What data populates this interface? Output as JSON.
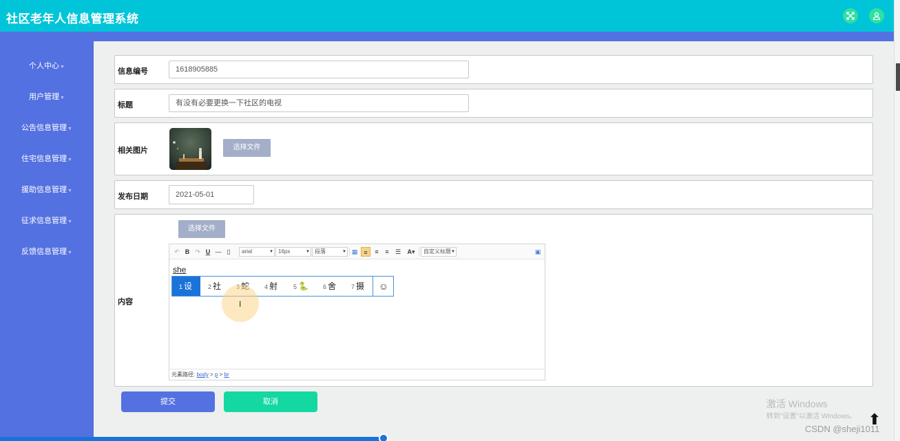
{
  "header": {
    "title": "社区老年人信息管理系统"
  },
  "sidebar": {
    "items": [
      {
        "label": "个人中心"
      },
      {
        "label": "用户管理"
      },
      {
        "label": "公告信息管理"
      },
      {
        "label": "住宅信息管理"
      },
      {
        "label": "援助信息管理"
      },
      {
        "label": "征求信息管理"
      },
      {
        "label": "反馈信息管理"
      }
    ]
  },
  "form": {
    "id_label": "信息编号",
    "id_value": "1618905885",
    "title_label": "标题",
    "title_value": "有没有必要更换一下社区的电视",
    "image_label": "相关图片",
    "image_button": "选择文件",
    "date_label": "发布日期",
    "date_value": "2021-05-01",
    "content_label": "内容",
    "content_button": "选择文件"
  },
  "editor": {
    "font_family": "arial",
    "font_size": "16px",
    "paragraph": "段落",
    "custom_title": "自定义标题",
    "typed_text": "she",
    "status_prefix": "元素路径:",
    "path_body": "body",
    "path_p": "p",
    "path_br": "br"
  },
  "ime": {
    "candidates": [
      {
        "num": "1",
        "text": "设"
      },
      {
        "num": "2",
        "text": "社"
      },
      {
        "num": "3",
        "text": "蛇"
      },
      {
        "num": "4",
        "text": "射"
      },
      {
        "num": "5",
        "text": "🐍"
      },
      {
        "num": "6",
        "text": "舍"
      },
      {
        "num": "7",
        "text": "摄"
      }
    ],
    "emoji_button": "☺"
  },
  "actions": {
    "submit": "提交",
    "cancel": "取消"
  },
  "watermark": {
    "line1": "激活 Windows",
    "line2": "转到\"设置\"以激活 Windows。"
  },
  "credit": "CSDN @sheji1011"
}
